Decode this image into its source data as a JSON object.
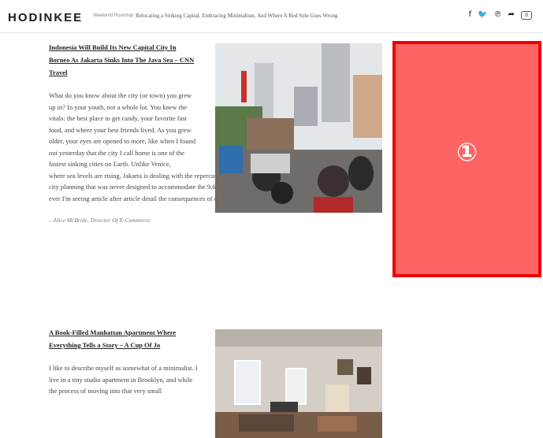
{
  "header": {
    "logo": "HODINKEE",
    "headline_label": "Weekend Roundup",
    "headline": "Relocating a Sinking Capital, Embracing Minimalism, And Where A Red Sole Goes Wrong",
    "share_icons": [
      "facebook-icon",
      "twitter-icon",
      "pinterest-icon",
      "share-icon",
      "comment-icon"
    ],
    "comment_count": "0"
  },
  "articles": [
    {
      "title": "Indonesia Will Build Its New Capital City In Borneo As Jakarta Sinks Into The Java Sea – CNN Travel",
      "body_narrow": "What do you know about the city (or town) you grew up in? In your youth, not a whole lot. You knew the vitals: the best place to get candy, your favorite fast food, and where your best friends lived. As you grew older, your eyes are opened to more, like when I found out yesterday that the city I call home is one of the fastest sinking cities on Earth. Unlike Venice,",
      "body_wide": "where sea levels are rising, Jakarta is dealing with the repercussions of excessive groundwater extraction and city planning that was never designed to accommodate the 9.6 million people that live there now. More than ever I'm seeing article after article detail the consequences of overpopulation – this one just hit home. Literally.",
      "credit": "– Alice McBride, Director Of E-Commerce"
    },
    {
      "title": "A Book-Filled Manhattan Apartment Where Everything Tells a Story – A Cup Of Jo",
      "body_narrow": "I like to describe myself as somewhat of a minimalist. I live in a tiny studio apartment in Brooklyn, and while the process of moving into that very small"
    }
  ],
  "ad": {
    "label": "①",
    "color": "#ff6464",
    "border_color": "#ee0000"
  }
}
